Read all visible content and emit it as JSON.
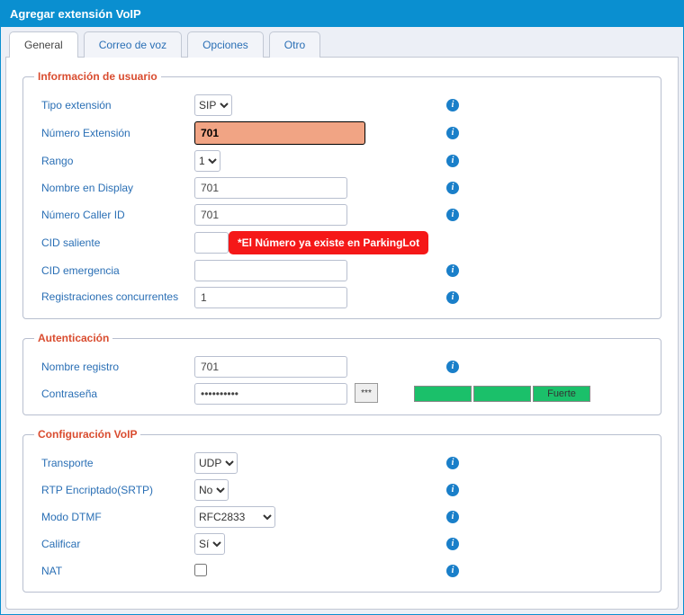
{
  "header": {
    "title": "Agregar extensión VoIP"
  },
  "tabs": {
    "general": "General",
    "voicemail": "Correo de voz",
    "options": "Opciones",
    "other": "Otro"
  },
  "sections": {
    "user_info": {
      "legend": "Información de usuario",
      "ext_type": {
        "label": "Tipo extensión",
        "options": [
          "SIP"
        ],
        "value": "SIP"
      },
      "ext_number": {
        "label": "Número Extensión",
        "value": "701"
      },
      "range": {
        "label": "Rango",
        "options": [
          "1"
        ],
        "value": "1"
      },
      "display_name": {
        "label": "Nombre en Display",
        "value": "701"
      },
      "caller_id_number": {
        "label": "Número Caller ID",
        "value": "701"
      },
      "outbound_cid": {
        "label": "CID saliente",
        "value": "",
        "error": "*El Número ya existe en ParkingLot"
      },
      "emergency_cid": {
        "label": "CID emergencia",
        "value": ""
      },
      "concurrent_reg": {
        "label": "Registraciones concurrentes",
        "value": "1"
      }
    },
    "auth": {
      "legend": "Autenticación",
      "reg_name": {
        "label": "Nombre registro",
        "value": "701"
      },
      "password": {
        "label": "Contraseña",
        "value": "••••••••••",
        "toggle": "***",
        "strength": "Fuerte"
      }
    },
    "voip": {
      "legend": "Configuración VoIP",
      "transport": {
        "label": "Transporte",
        "options": [
          "UDP"
        ],
        "value": "UDP"
      },
      "srtp": {
        "label": "RTP Encriptado(SRTP)",
        "options": [
          "No"
        ],
        "value": "No"
      },
      "dtmf": {
        "label": "Modo DTMF",
        "options": [
          "RFC2833"
        ],
        "value": "RFC2833"
      },
      "qualify": {
        "label": "Calificar",
        "options": [
          "Sí"
        ],
        "value": "Sí"
      },
      "nat": {
        "label": "NAT",
        "checked": false
      }
    }
  }
}
